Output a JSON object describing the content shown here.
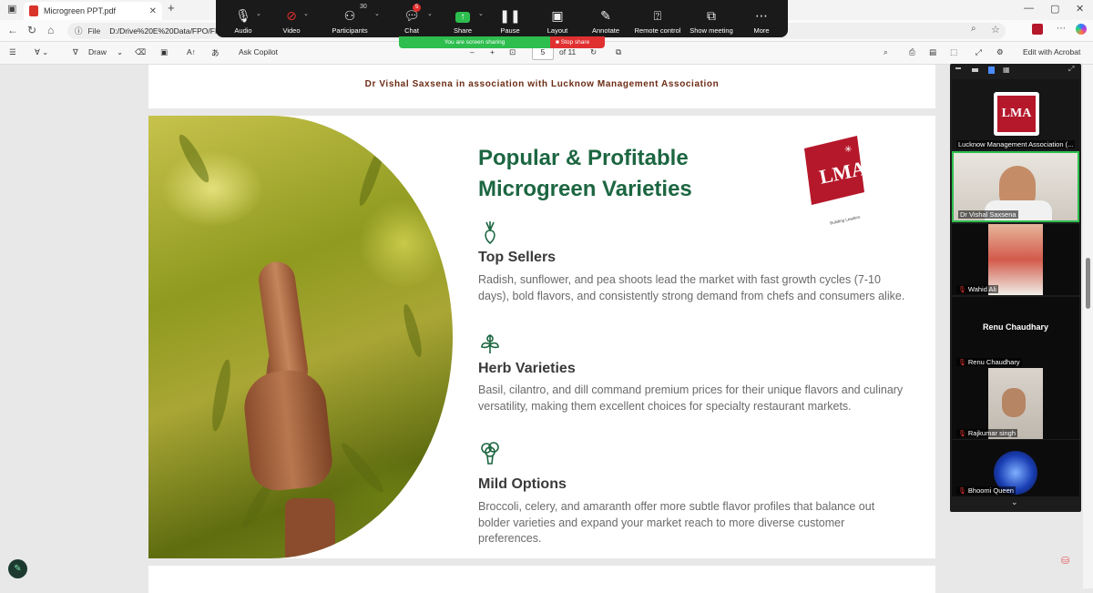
{
  "browser": {
    "tab_title": "Microgreen PPT.pdf",
    "new_tab": "+",
    "url_label": "File",
    "url": "D:/Drive%20E%20Data/FPO/FPO"
  },
  "pdf_toolbar": {
    "draw": "Draw",
    "ask_copilot": "Ask Copilot",
    "zoom_out": "–",
    "zoom_in": "+",
    "page": "5",
    "of_pages": "of 11",
    "edit_acrobat": "Edit with Acrobat"
  },
  "zoom_toolbar": {
    "audio": "Audio",
    "video": "Video",
    "participants": "Participants",
    "participants_count": "30",
    "chat": "Chat",
    "chat_badge": "5",
    "share": "Share",
    "pause": "Pause",
    "layout": "Layout",
    "annotate": "Annotate",
    "remote_control": "Remote control",
    "show_meeting": "Show meeting",
    "more": "More",
    "sharing_status": "You are screen sharing",
    "stop_share": "Stop share"
  },
  "document": {
    "header": "Dr Vishal Saxsena in association with Lucknow Management Association",
    "slide_title": "Popular & Profitable Microgreen Varieties",
    "logo_text": "LMA",
    "logo_tagline": "Building Leaders",
    "sections": [
      {
        "heading": "Top Sellers",
        "body": "Radish, sunflower, and pea shoots lead the market with fast growth cycles (7-10 days), bold flavors, and consistently strong demand from chefs and consumers alike.",
        "icon": "radish-icon"
      },
      {
        "heading": "Herb Varieties",
        "body": "Basil, cilantro, and dill command premium prices for their unique flavors and culinary versatility, making them excellent choices for specialty restaurant markets.",
        "icon": "herb-icon"
      },
      {
        "heading": "Mild Options",
        "body": "Broccoli, celery, and amaranth offer more subtle flavor profiles that balance out bolder varieties and expand your market reach to more diverse customer preferences.",
        "icon": "broccoli-icon"
      }
    ]
  },
  "participants": [
    {
      "name": "Lucknow Management Association (...",
      "muted": false
    },
    {
      "name": "Dr Vishal Saxsena",
      "muted": false
    },
    {
      "name": "Wahid Ali",
      "muted": true
    },
    {
      "name": "Renu Chaudhary",
      "muted": true,
      "title": "Renu Chaudhary"
    },
    {
      "name": "Rajkumar singh",
      "muted": true
    },
    {
      "name": "Bhoomi Queen",
      "muted": true
    }
  ],
  "colors": {
    "accent_green": "#1c6641",
    "header_brown": "#6b2b14",
    "share_green": "#2dbe4e",
    "stop_red": "#e03030",
    "logo_red": "#b5182a"
  }
}
